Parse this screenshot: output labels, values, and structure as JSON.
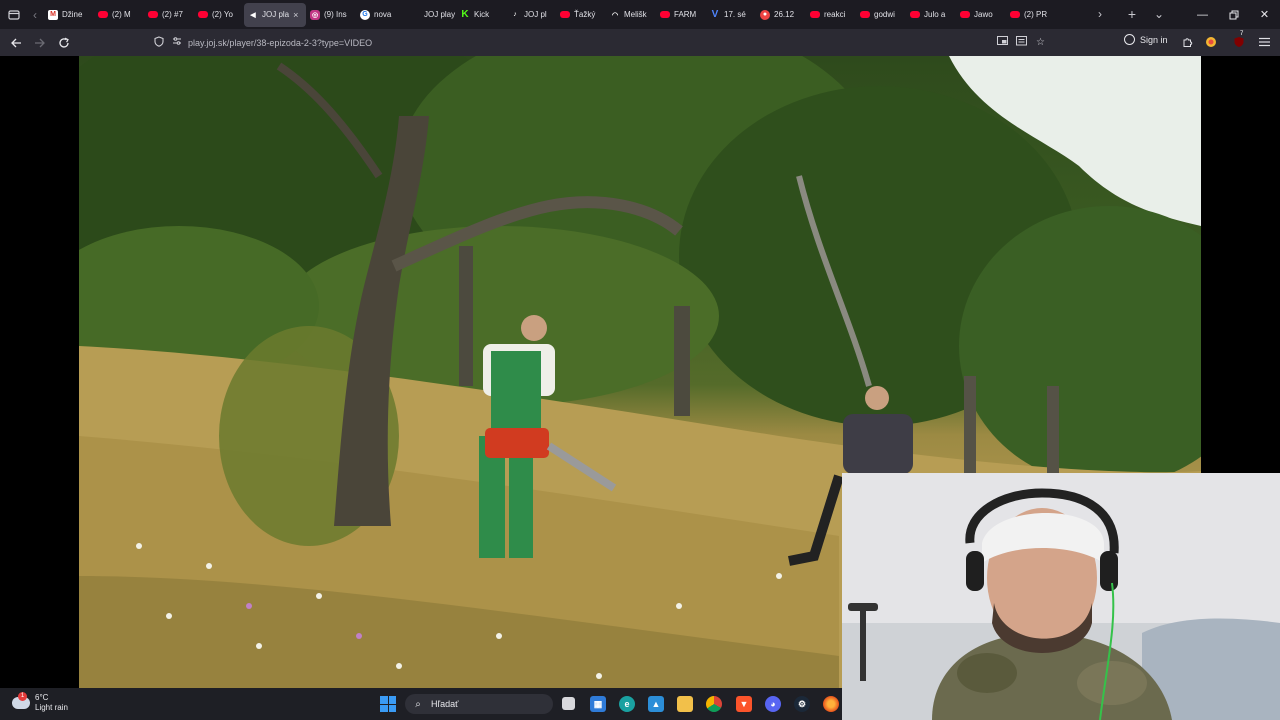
{
  "browser": {
    "tabs": [
      {
        "label": "Džine",
        "icon": "gmail-icon",
        "glyph": "M",
        "kind": "gmail"
      },
      {
        "label": "(2) M",
        "icon": "youtube-icon",
        "glyph": "",
        "kind": "yt"
      },
      {
        "label": "(2) #7",
        "icon": "youtube-icon",
        "glyph": "",
        "kind": "yt"
      },
      {
        "label": "(2) Yo",
        "icon": "youtube-icon",
        "glyph": "",
        "kind": "yt"
      },
      {
        "label": "JOJ pla",
        "icon": "speaker-icon",
        "glyph": "◀",
        "kind": "joj",
        "active": true
      },
      {
        "label": "(9) Ins",
        "icon": "instagram-icon",
        "glyph": "◎",
        "kind": "ig"
      },
      {
        "label": "nova",
        "icon": "chrome-icon",
        "glyph": "G",
        "kind": "chrome"
      },
      {
        "label": "JOJ play",
        "icon": "blank-icon",
        "glyph": "",
        "kind": "joj"
      },
      {
        "label": "Kick",
        "icon": "kick-icon",
        "glyph": "K",
        "kind": "kick"
      },
      {
        "label": "JOJ pl",
        "icon": "joj-icon",
        "glyph": "♪",
        "kind": "joj"
      },
      {
        "label": "Ťažký",
        "icon": "youtube-icon",
        "glyph": "",
        "kind": "yt"
      },
      {
        "label": "Melišk",
        "icon": "headset-icon",
        "glyph": "◠",
        "kind": "joj"
      },
      {
        "label": "FARM",
        "icon": "youtube-icon",
        "glyph": "",
        "kind": "yt"
      },
      {
        "label": "17. sé",
        "icon": "v-icon",
        "glyph": "V",
        "kind": "v"
      },
      {
        "label": "26.12",
        "icon": "red-circle-icon",
        "glyph": "●",
        "kind": "red"
      },
      {
        "label": "reakci",
        "icon": "youtube-icon",
        "glyph": "",
        "kind": "yt"
      },
      {
        "label": "godwi",
        "icon": "youtube-icon",
        "glyph": "",
        "kind": "yt"
      },
      {
        "label": "Julo a",
        "icon": "youtube-icon",
        "glyph": "",
        "kind": "yt"
      },
      {
        "label": "Jawo",
        "icon": "youtube-icon",
        "glyph": "",
        "kind": "yt"
      },
      {
        "label": "(2) PR",
        "icon": "youtube-icon",
        "glyph": "",
        "kind": "yt"
      }
    ],
    "tab_close": "×",
    "url": "play.joj.sk/player/38-epizoda-2-3?type=VIDEO",
    "signin_label": "Sign in",
    "extension_badge": "7"
  },
  "taskbar": {
    "temperature": "6°C",
    "weather": "Light rain",
    "weather_badge": "1",
    "search_placeholder": "Hľadať"
  }
}
